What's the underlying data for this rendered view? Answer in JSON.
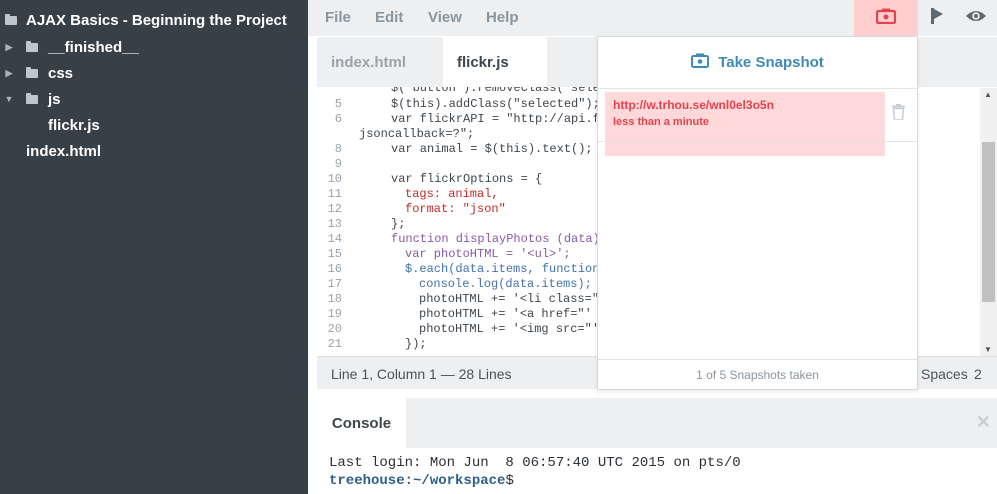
{
  "sidebar": {
    "project_title": "AJAX Basics - Beginning the Project",
    "items": [
      {
        "label": "__finished__",
        "type": "folder",
        "expanded": false
      },
      {
        "label": "css",
        "type": "folder",
        "expanded": false
      },
      {
        "label": "js",
        "type": "folder",
        "expanded": true
      },
      {
        "label": "flickr.js",
        "type": "file"
      },
      {
        "label": "index.html",
        "type": "file"
      }
    ]
  },
  "menubar": {
    "items": [
      "File",
      "Edit",
      "View",
      "Help"
    ],
    "icons": [
      "camera-icon",
      "share-icon",
      "eye-icon"
    ]
  },
  "editor": {
    "tabs": [
      {
        "label": "index.html",
        "active": false
      },
      {
        "label": "flickr.js",
        "active": true
      }
    ],
    "lines": [
      {
        "n": "",
        "text": "$(\"button\").removeClass(\"sele"
      },
      {
        "n": "5",
        "text": "$(this).addClass(\"selected\");"
      },
      {
        "n": "6",
        "text": "var flickrAPI = \"http://api.f"
      },
      {
        "n": "7",
        "text": "jsoncallback=?\";"
      },
      {
        "n": "8",
        "text": "var animal = $(this).text();"
      },
      {
        "n": "9",
        "text": ""
      },
      {
        "n": "10",
        "text": "var flickrOptions = {"
      },
      {
        "n": "11",
        "text": "tags: animal,"
      },
      {
        "n": "12",
        "text": "format: \"json\""
      },
      {
        "n": "13",
        "text": "};"
      },
      {
        "n": "14",
        "text": "function displayPhotos (data)"
      },
      {
        "n": "15",
        "text": "var photoHTML = '<ul>';"
      },
      {
        "n": "16",
        "text": "$.each(data.items, function"
      },
      {
        "n": "17",
        "text": "console.log(data.items);"
      },
      {
        "n": "18",
        "text": "photoHTML += '<li class=\""
      },
      {
        "n": "19",
        "text": "photoHTML += '<a href=\"'"
      },
      {
        "n": "20",
        "text": "photoHTML += '<img src=\"'"
      },
      {
        "n": "21",
        "text": "});"
      }
    ],
    "status_left": "Line 1, Column 1 — 28 Lines",
    "status_right": "Spaces",
    "status_right_value": "2"
  },
  "snapshot": {
    "header": "Take Snapshot",
    "items": [
      {
        "url": "http://w.trhou.se/wnl0el3o5n",
        "time": "less than a minute"
      }
    ],
    "footer": "1 of 5 Snapshots taken"
  },
  "console": {
    "tab_label": "Console",
    "lines": [
      "Last login: Mon Jun  8 06:57:40 UTC 2015 on pts/0"
    ],
    "prompt_user": "treehouse",
    "prompt_path": ":~/workspace",
    "prompt_suffix": "$"
  },
  "colors": {
    "sidebar_bg": "#384047",
    "accent_blue": "#3f8ab6",
    "snapshot_red": "#e8414e",
    "snapshot_highlight": "#ffd9d9",
    "console_user_blue": "#2f5f8a"
  }
}
